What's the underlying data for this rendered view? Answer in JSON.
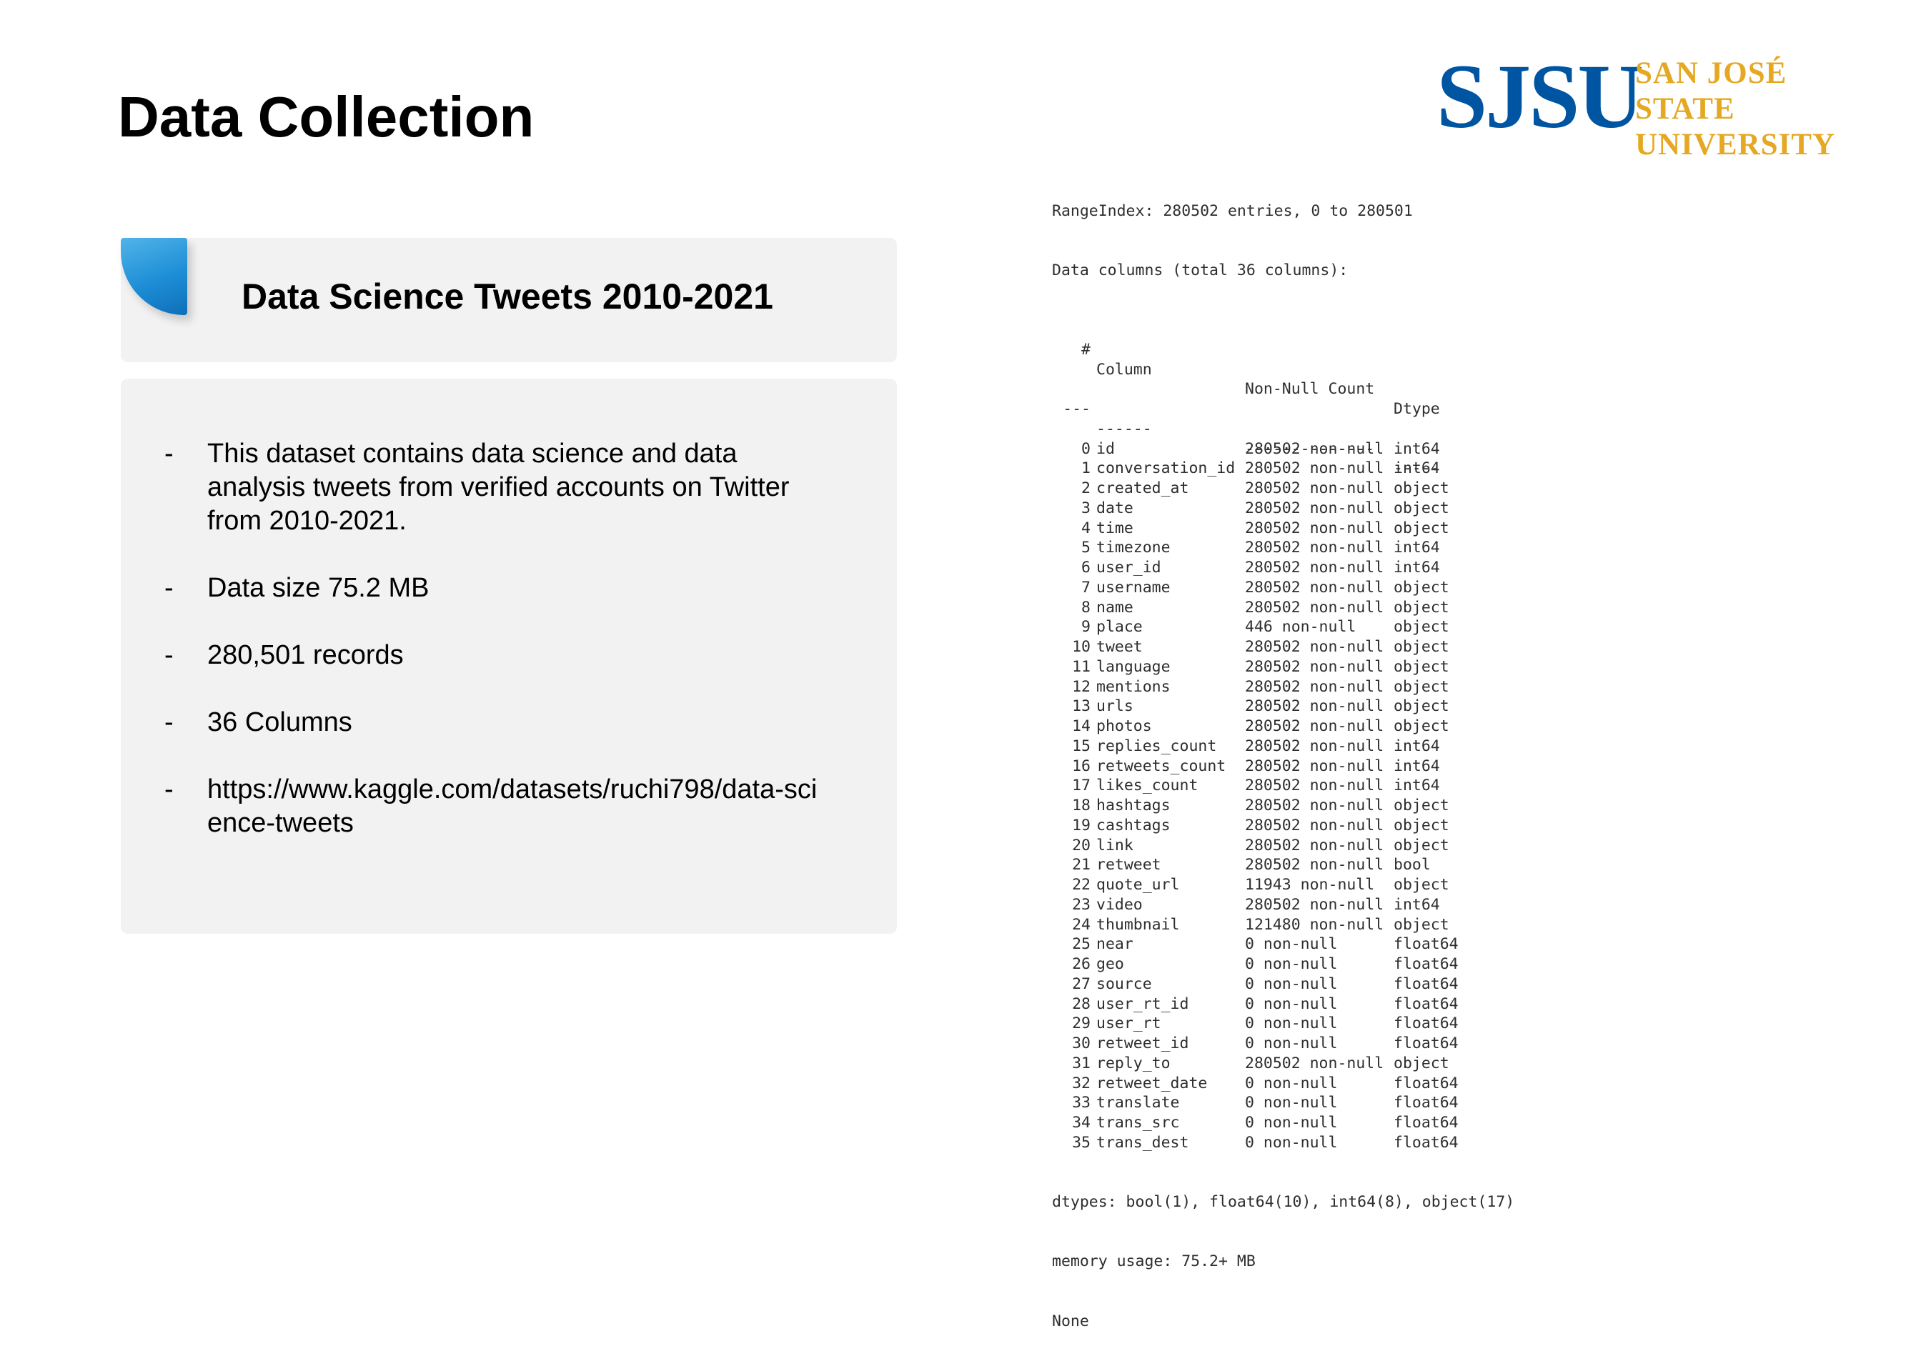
{
  "title": "Data Collection",
  "logo": {
    "abbr": "SJSU",
    "name_line1": "SAN JOSÉ STATE",
    "name_line2": "UNIVERSITY",
    "abbr_color": "#0055a2",
    "name_color": "#e5a823"
  },
  "card": {
    "heading": "Data Science Tweets 2010-2021",
    "accent_color": "#1d8ed6",
    "bullets": [
      {
        "dash": "-",
        "text": "This dataset contains data science and data analysis tweets from verified accounts on Twitter from 2010-2021."
      },
      {
        "dash": "-",
        "text": "Data size 75.2 MB"
      },
      {
        "dash": "-",
        "text": "280,501 records"
      },
      {
        "dash": "-",
        "text": "36 Columns"
      },
      {
        "dash": "-",
        "text": "https://www.kaggle.com/datasets/ruchi798/data-science-tweets"
      }
    ]
  },
  "info": {
    "range_index": "RangeIndex: 280502 entries, 0 to 280501",
    "data_columns": "Data columns (total 36 columns):",
    "header": {
      "num": "#",
      "column": "Column",
      "count": "Non-Null Count",
      "dtype": "Dtype"
    },
    "separator": {
      "num": "---",
      "column": "------",
      "count": "--------------",
      "dtype": "-----"
    },
    "rows": [
      {
        "num": "0",
        "column": "id",
        "count": "280502 non-null",
        "dtype": "int64"
      },
      {
        "num": "1",
        "column": "conversation_id",
        "count": "280502 non-null",
        "dtype": "int64"
      },
      {
        "num": "2",
        "column": "created_at",
        "count": "280502 non-null",
        "dtype": "object"
      },
      {
        "num": "3",
        "column": "date",
        "count": "280502 non-null",
        "dtype": "object"
      },
      {
        "num": "4",
        "column": "time",
        "count": "280502 non-null",
        "dtype": "object"
      },
      {
        "num": "5",
        "column": "timezone",
        "count": "280502 non-null",
        "dtype": "int64"
      },
      {
        "num": "6",
        "column": "user_id",
        "count": "280502 non-null",
        "dtype": "int64"
      },
      {
        "num": "7",
        "column": "username",
        "count": "280502 non-null",
        "dtype": "object"
      },
      {
        "num": "8",
        "column": "name",
        "count": "280502 non-null",
        "dtype": "object"
      },
      {
        "num": "9",
        "column": "place",
        "count": "446 non-null",
        "dtype": "object"
      },
      {
        "num": "10",
        "column": "tweet",
        "count": "280502 non-null",
        "dtype": "object"
      },
      {
        "num": "11",
        "column": "language",
        "count": "280502 non-null",
        "dtype": "object"
      },
      {
        "num": "12",
        "column": "mentions",
        "count": "280502 non-null",
        "dtype": "object"
      },
      {
        "num": "13",
        "column": "urls",
        "count": "280502 non-null",
        "dtype": "object"
      },
      {
        "num": "14",
        "column": "photos",
        "count": "280502 non-null",
        "dtype": "object"
      },
      {
        "num": "15",
        "column": "replies_count",
        "count": "280502 non-null",
        "dtype": "int64"
      },
      {
        "num": "16",
        "column": "retweets_count",
        "count": "280502 non-null",
        "dtype": "int64"
      },
      {
        "num": "17",
        "column": "likes_count",
        "count": "280502 non-null",
        "dtype": "int64"
      },
      {
        "num": "18",
        "column": "hashtags",
        "count": "280502 non-null",
        "dtype": "object"
      },
      {
        "num": "19",
        "column": "cashtags",
        "count": "280502 non-null",
        "dtype": "object"
      },
      {
        "num": "20",
        "column": "link",
        "count": "280502 non-null",
        "dtype": "object"
      },
      {
        "num": "21",
        "column": "retweet",
        "count": "280502 non-null",
        "dtype": "bool"
      },
      {
        "num": "22",
        "column": "quote_url",
        "count": "11943 non-null",
        "dtype": "object"
      },
      {
        "num": "23",
        "column": "video",
        "count": "280502 non-null",
        "dtype": "int64"
      },
      {
        "num": "24",
        "column": "thumbnail",
        "count": "121480 non-null",
        "dtype": "object"
      },
      {
        "num": "25",
        "column": "near",
        "count": "0 non-null",
        "dtype": "float64"
      },
      {
        "num": "26",
        "column": "geo",
        "count": "0 non-null",
        "dtype": "float64"
      },
      {
        "num": "27",
        "column": "source",
        "count": "0 non-null",
        "dtype": "float64"
      },
      {
        "num": "28",
        "column": "user_rt_id",
        "count": "0 non-null",
        "dtype": "float64"
      },
      {
        "num": "29",
        "column": "user_rt",
        "count": "0 non-null",
        "dtype": "float64"
      },
      {
        "num": "30",
        "column": "retweet_id",
        "count": "0 non-null",
        "dtype": "float64"
      },
      {
        "num": "31",
        "column": "reply_to",
        "count": "280502 non-null",
        "dtype": "object"
      },
      {
        "num": "32",
        "column": "retweet_date",
        "count": "0 non-null",
        "dtype": "float64"
      },
      {
        "num": "33",
        "column": "translate",
        "count": "0 non-null",
        "dtype": "float64"
      },
      {
        "num": "34",
        "column": "trans_src",
        "count": "0 non-null",
        "dtype": "float64"
      },
      {
        "num": "35",
        "column": "trans_dest",
        "count": "0 non-null",
        "dtype": "float64"
      }
    ],
    "dtypes": "dtypes: bool(1), float64(10), int64(8), object(17)",
    "memory": "memory usage: 75.2+ MB",
    "none": "None"
  }
}
